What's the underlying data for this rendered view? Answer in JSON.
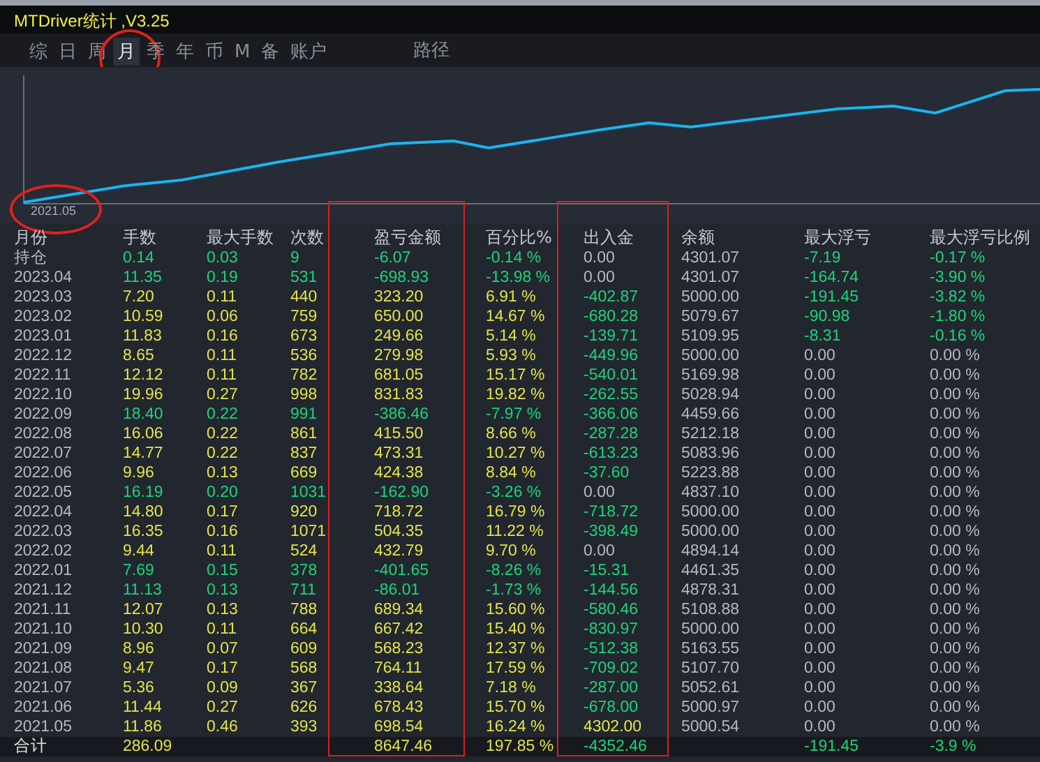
{
  "window": {
    "title": "MTDriver统计 ,V3.25"
  },
  "tabs": [
    {
      "label": "综",
      "selected": false,
      "circled": false
    },
    {
      "label": "日",
      "selected": false,
      "circled": false
    },
    {
      "label": "周",
      "selected": false,
      "circled": false
    },
    {
      "label": "月",
      "selected": true,
      "circled": true
    },
    {
      "label": "季",
      "selected": false,
      "circled": false
    },
    {
      "label": "年",
      "selected": false,
      "circled": false
    },
    {
      "label": "币",
      "selected": false,
      "circled": false
    },
    {
      "label": "M",
      "selected": false,
      "circled": false
    },
    {
      "label": "备",
      "selected": false,
      "circled": false
    },
    {
      "label": "账户",
      "selected": false,
      "circled": false
    }
  ],
  "path_tab": {
    "label": "路径",
    "selected": false
  },
  "chart": {
    "start_label": "2021.05",
    "start_label_circled": true
  },
  "table": {
    "columns": [
      {
        "label": "月份",
        "boxed": false
      },
      {
        "label": "手数",
        "boxed": false
      },
      {
        "label": "最大手数",
        "boxed": false
      },
      {
        "label": "次数",
        "boxed": false
      },
      {
        "label": "盈亏金额",
        "boxed": true
      },
      {
        "label": "百分比%",
        "boxed": false
      },
      {
        "label": "出入金",
        "boxed": true
      },
      {
        "label": "余额",
        "boxed": false
      },
      {
        "label": "最大浮亏",
        "boxed": false
      },
      {
        "label": "最大浮亏比例",
        "boxed": false
      }
    ],
    "rows": [
      {
        "label": "持仓",
        "color": "#1fd37a",
        "lots": "0.14",
        "max_lots": "0.03",
        "trades": "9",
        "profit": "-6.07",
        "percent": "-0.14 %",
        "cashflow": {
          "text": "0.00",
          "color": "#b4b8c0"
        },
        "balance": "4301.07",
        "max_float_loss": {
          "text": "-7.19",
          "color": "#1fd37a"
        },
        "max_float_loss_pct": {
          "text": "-0.17 %",
          "color": "#1fd37a"
        }
      },
      {
        "label": "2023.04",
        "color": "#1fd37a",
        "lots": "11.35",
        "max_lots": "0.19",
        "trades": "531",
        "profit": "-698.93",
        "percent": "-13.98 %",
        "cashflow": {
          "text": "0.00",
          "color": "#b4b8c0"
        },
        "balance": "4301.07",
        "max_float_loss": {
          "text": "-164.74",
          "color": "#1fd37a"
        },
        "max_float_loss_pct": {
          "text": "-3.90 %",
          "color": "#1fd37a"
        }
      },
      {
        "label": "2023.03",
        "color": "#e4e44c",
        "lots": "7.20",
        "max_lots": "0.11",
        "trades": "440",
        "profit": "323.20",
        "percent": "6.91 %",
        "cashflow": {
          "text": "-402.87",
          "color": "#1fd37a"
        },
        "balance": "5000.00",
        "max_float_loss": {
          "text": "-191.45",
          "color": "#1fd37a"
        },
        "max_float_loss_pct": {
          "text": "-3.82 %",
          "color": "#1fd37a"
        }
      },
      {
        "label": "2023.02",
        "color": "#e4e44c",
        "lots": "10.59",
        "max_lots": "0.06",
        "trades": "759",
        "profit": "650.00",
        "percent": "14.67 %",
        "cashflow": {
          "text": "-680.28",
          "color": "#1fd37a"
        },
        "balance": "5079.67",
        "max_float_loss": {
          "text": "-90.98",
          "color": "#1fd37a"
        },
        "max_float_loss_pct": {
          "text": "-1.80 %",
          "color": "#1fd37a"
        }
      },
      {
        "label": "2023.01",
        "color": "#e4e44c",
        "lots": "11.83",
        "max_lots": "0.16",
        "trades": "673",
        "profit": "249.66",
        "percent": "5.14 %",
        "cashflow": {
          "text": "-139.71",
          "color": "#1fd37a"
        },
        "balance": "5109.95",
        "max_float_loss": {
          "text": "-8.31",
          "color": "#1fd37a"
        },
        "max_float_loss_pct": {
          "text": "-0.16 %",
          "color": "#1fd37a"
        }
      },
      {
        "label": "2022.12",
        "color": "#e4e44c",
        "lots": "8.65",
        "max_lots": "0.11",
        "trades": "536",
        "profit": "279.98",
        "percent": "5.93 %",
        "cashflow": {
          "text": "-449.96",
          "color": "#1fd37a"
        },
        "balance": "5000.00",
        "max_float_loss": {
          "text": "0.00",
          "color": "#b4b8c0"
        },
        "max_float_loss_pct": {
          "text": "0.00 %",
          "color": "#b4b8c0"
        }
      },
      {
        "label": "2022.11",
        "color": "#e4e44c",
        "lots": "12.12",
        "max_lots": "0.11",
        "trades": "782",
        "profit": "681.05",
        "percent": "15.17 %",
        "cashflow": {
          "text": "-540.01",
          "color": "#1fd37a"
        },
        "balance": "5169.98",
        "max_float_loss": {
          "text": "0.00",
          "color": "#b4b8c0"
        },
        "max_float_loss_pct": {
          "text": "0.00 %",
          "color": "#b4b8c0"
        }
      },
      {
        "label": "2022.10",
        "color": "#e4e44c",
        "lots": "19.96",
        "max_lots": "0.27",
        "trades": "998",
        "profit": "831.83",
        "percent": "19.82 %",
        "cashflow": {
          "text": "-262.55",
          "color": "#1fd37a"
        },
        "balance": "5028.94",
        "max_float_loss": {
          "text": "0.00",
          "color": "#b4b8c0"
        },
        "max_float_loss_pct": {
          "text": "0.00 %",
          "color": "#b4b8c0"
        }
      },
      {
        "label": "2022.09",
        "color": "#1fd37a",
        "lots": "18.40",
        "max_lots": "0.22",
        "trades": "991",
        "profit": "-386.46",
        "percent": "-7.97 %",
        "cashflow": {
          "text": "-366.06",
          "color": "#1fd37a"
        },
        "balance": "4459.66",
        "max_float_loss": {
          "text": "0.00",
          "color": "#b4b8c0"
        },
        "max_float_loss_pct": {
          "text": "0.00 %",
          "color": "#b4b8c0"
        }
      },
      {
        "label": "2022.08",
        "color": "#e4e44c",
        "lots": "16.06",
        "max_lots": "0.22",
        "trades": "861",
        "profit": "415.50",
        "percent": "8.66 %",
        "cashflow": {
          "text": "-287.28",
          "color": "#1fd37a"
        },
        "balance": "5212.18",
        "max_float_loss": {
          "text": "0.00",
          "color": "#b4b8c0"
        },
        "max_float_loss_pct": {
          "text": "0.00 %",
          "color": "#b4b8c0"
        }
      },
      {
        "label": "2022.07",
        "color": "#e4e44c",
        "lots": "14.77",
        "max_lots": "0.22",
        "trades": "837",
        "profit": "473.31",
        "percent": "10.27 %",
        "cashflow": {
          "text": "-613.23",
          "color": "#1fd37a"
        },
        "balance": "5083.96",
        "max_float_loss": {
          "text": "0.00",
          "color": "#b4b8c0"
        },
        "max_float_loss_pct": {
          "text": "0.00 %",
          "color": "#b4b8c0"
        }
      },
      {
        "label": "2022.06",
        "color": "#e4e44c",
        "lots": "9.96",
        "max_lots": "0.13",
        "trades": "669",
        "profit": "424.38",
        "percent": "8.84 %",
        "cashflow": {
          "text": "-37.60",
          "color": "#1fd37a"
        },
        "balance": "5223.88",
        "max_float_loss": {
          "text": "0.00",
          "color": "#b4b8c0"
        },
        "max_float_loss_pct": {
          "text": "0.00 %",
          "color": "#b4b8c0"
        }
      },
      {
        "label": "2022.05",
        "color": "#1fd37a",
        "lots": "16.19",
        "max_lots": "0.20",
        "trades": "1031",
        "profit": "-162.90",
        "percent": "-3.26 %",
        "cashflow": {
          "text": "0.00",
          "color": "#b4b8c0"
        },
        "balance": "4837.10",
        "max_float_loss": {
          "text": "0.00",
          "color": "#b4b8c0"
        },
        "max_float_loss_pct": {
          "text": "0.00 %",
          "color": "#b4b8c0"
        }
      },
      {
        "label": "2022.04",
        "color": "#e4e44c",
        "lots": "14.80",
        "max_lots": "0.17",
        "trades": "920",
        "profit": "718.72",
        "percent": "16.79 %",
        "cashflow": {
          "text": "-718.72",
          "color": "#1fd37a"
        },
        "balance": "5000.00",
        "max_float_loss": {
          "text": "0.00",
          "color": "#b4b8c0"
        },
        "max_float_loss_pct": {
          "text": "0.00 %",
          "color": "#b4b8c0"
        }
      },
      {
        "label": "2022.03",
        "color": "#e4e44c",
        "lots": "16.35",
        "max_lots": "0.16",
        "trades": "1071",
        "profit": "504.35",
        "percent": "11.22 %",
        "cashflow": {
          "text": "-398.49",
          "color": "#1fd37a"
        },
        "balance": "5000.00",
        "max_float_loss": {
          "text": "0.00",
          "color": "#b4b8c0"
        },
        "max_float_loss_pct": {
          "text": "0.00 %",
          "color": "#b4b8c0"
        }
      },
      {
        "label": "2022.02",
        "color": "#e4e44c",
        "lots": "9.44",
        "max_lots": "0.11",
        "trades": "524",
        "profit": "432.79",
        "percent": "9.70 %",
        "cashflow": {
          "text": "0.00",
          "color": "#b4b8c0"
        },
        "balance": "4894.14",
        "max_float_loss": {
          "text": "0.00",
          "color": "#b4b8c0"
        },
        "max_float_loss_pct": {
          "text": "0.00 %",
          "color": "#b4b8c0"
        }
      },
      {
        "label": "2022.01",
        "color": "#1fd37a",
        "lots": "7.69",
        "max_lots": "0.15",
        "trades": "378",
        "profit": "-401.65",
        "percent": "-8.26 %",
        "cashflow": {
          "text": "-15.31",
          "color": "#1fd37a"
        },
        "balance": "4461.35",
        "max_float_loss": {
          "text": "0.00",
          "color": "#b4b8c0"
        },
        "max_float_loss_pct": {
          "text": "0.00 %",
          "color": "#b4b8c0"
        }
      },
      {
        "label": "2021.12",
        "color": "#1fd37a",
        "lots": "11.13",
        "max_lots": "0.13",
        "trades": "711",
        "profit": "-86.01",
        "percent": "-1.73 %",
        "cashflow": {
          "text": "-144.56",
          "color": "#1fd37a"
        },
        "balance": "4878.31",
        "max_float_loss": {
          "text": "0.00",
          "color": "#b4b8c0"
        },
        "max_float_loss_pct": {
          "text": "0.00 %",
          "color": "#b4b8c0"
        }
      },
      {
        "label": "2021.11",
        "color": "#e4e44c",
        "lots": "12.07",
        "max_lots": "0.13",
        "trades": "788",
        "profit": "689.34",
        "percent": "15.60 %",
        "cashflow": {
          "text": "-580.46",
          "color": "#1fd37a"
        },
        "balance": "5108.88",
        "max_float_loss": {
          "text": "0.00",
          "color": "#b4b8c0"
        },
        "max_float_loss_pct": {
          "text": "0.00 %",
          "color": "#b4b8c0"
        }
      },
      {
        "label": "2021.10",
        "color": "#e4e44c",
        "lots": "10.30",
        "max_lots": "0.11",
        "trades": "664",
        "profit": "667.42",
        "percent": "15.40 %",
        "cashflow": {
          "text": "-830.97",
          "color": "#1fd37a"
        },
        "balance": "5000.00",
        "max_float_loss": {
          "text": "0.00",
          "color": "#b4b8c0"
        },
        "max_float_loss_pct": {
          "text": "0.00 %",
          "color": "#b4b8c0"
        }
      },
      {
        "label": "2021.09",
        "color": "#e4e44c",
        "lots": "8.96",
        "max_lots": "0.07",
        "trades": "609",
        "profit": "568.23",
        "percent": "12.37 %",
        "cashflow": {
          "text": "-512.38",
          "color": "#1fd37a"
        },
        "balance": "5163.55",
        "max_float_loss": {
          "text": "0.00",
          "color": "#b4b8c0"
        },
        "max_float_loss_pct": {
          "text": "0.00 %",
          "color": "#b4b8c0"
        }
      },
      {
        "label": "2021.08",
        "color": "#e4e44c",
        "lots": "9.47",
        "max_lots": "0.17",
        "trades": "568",
        "profit": "764.11",
        "percent": "17.59 %",
        "cashflow": {
          "text": "-709.02",
          "color": "#1fd37a"
        },
        "balance": "5107.70",
        "max_float_loss": {
          "text": "0.00",
          "color": "#b4b8c0"
        },
        "max_float_loss_pct": {
          "text": "0.00 %",
          "color": "#b4b8c0"
        }
      },
      {
        "label": "2021.07",
        "color": "#e4e44c",
        "lots": "5.36",
        "max_lots": "0.09",
        "trades": "367",
        "profit": "338.64",
        "percent": "7.18 %",
        "cashflow": {
          "text": "-287.00",
          "color": "#1fd37a"
        },
        "balance": "5052.61",
        "max_float_loss": {
          "text": "0.00",
          "color": "#b4b8c0"
        },
        "max_float_loss_pct": {
          "text": "0.00 %",
          "color": "#b4b8c0"
        }
      },
      {
        "label": "2021.06",
        "color": "#e4e44c",
        "lots": "11.44",
        "max_lots": "0.27",
        "trades": "626",
        "profit": "678.43",
        "percent": "15.70 %",
        "cashflow": {
          "text": "-678.00",
          "color": "#1fd37a"
        },
        "balance": "5000.97",
        "max_float_loss": {
          "text": "0.00",
          "color": "#b4b8c0"
        },
        "max_float_loss_pct": {
          "text": "0.00 %",
          "color": "#b4b8c0"
        }
      },
      {
        "label": "2021.05",
        "color": "#e4e44c",
        "lots": "11.86",
        "max_lots": "0.46",
        "trades": "393",
        "profit": "698.54",
        "percent": "16.24 %",
        "cashflow": {
          "text": "4302.00",
          "color": "#e4e44c"
        },
        "balance": "5000.54",
        "max_float_loss": {
          "text": "0.00",
          "color": "#b4b8c0"
        },
        "max_float_loss_pct": {
          "text": "0.00 %",
          "color": "#b4b8c0"
        }
      }
    ],
    "total": {
      "label": "合计",
      "color": "#e4e44c",
      "lots": "286.09",
      "profit": "8647.46",
      "percent": "197.85 %",
      "cashflow": {
        "text": "-4352.46",
        "color": "#1fd37a"
      },
      "max_float_loss": {
        "text": "-191.45",
        "color": "#1fd37a"
      },
      "max_float_loss_pct": {
        "text": "-3.9 %",
        "color": "#1fd37a"
      }
    }
  }
}
